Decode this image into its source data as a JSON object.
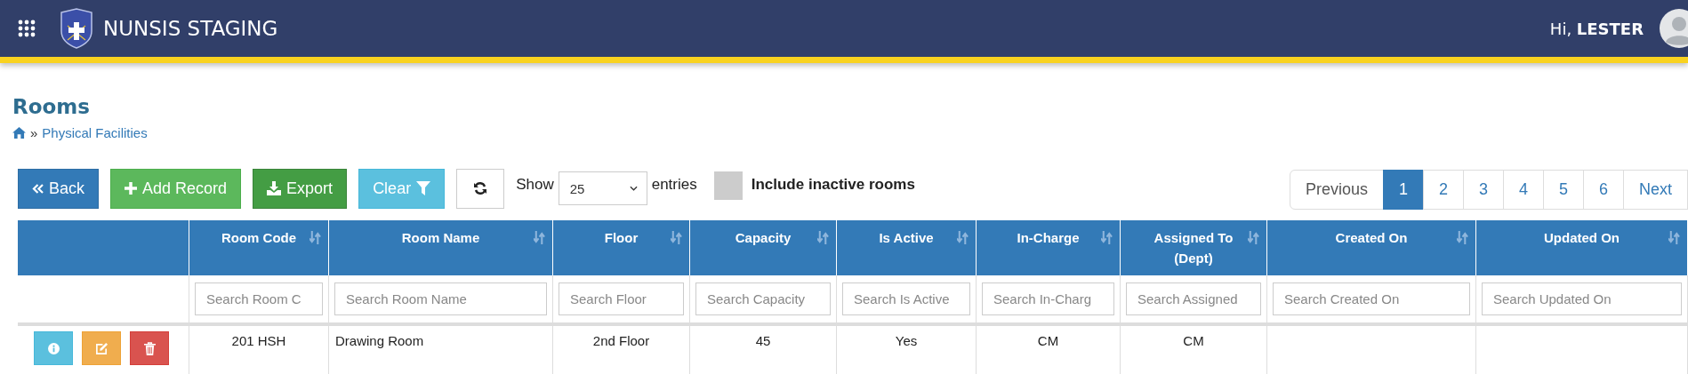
{
  "header": {
    "title": "NUNSIS STAGING",
    "greeting": "Hi, **LESTER**"
  },
  "page": {
    "title": "Rooms",
    "breadcrumb_separator": "»",
    "breadcrumb": "Physical Facilities"
  },
  "toolbar": {
    "buttons": [
      {
        "label": "Back",
        "kind": "back"
      },
      {
        "label": "Add Record",
        "kind": "add"
      },
      {
        "label": "Export",
        "kind": "export"
      },
      {
        "label": "Clear",
        "kind": "clear"
      },
      {
        "kind": "refresh"
      }
    ],
    "show_label": "Show",
    "entries_value": "25",
    "entries_label": "entries",
    "include_inactive": {
      "label": "Include inactive rooms",
      "checked": false
    }
  },
  "pagination": [
    {
      "label": "Previous",
      "selected": false
    },
    {
      "label": "1",
      "selected": true
    },
    {
      "label": "2",
      "selected": false
    },
    {
      "label": "3",
      "selected": false
    },
    {
      "label": "4",
      "selected": false
    },
    {
      "label": "5",
      "selected": false
    },
    {
      "label": "6",
      "selected": false
    },
    {
      "label": "Next",
      "selected": false
    }
  ],
  "table": {
    "columns": [
      {
        "label": "Room Code",
        "placeholder": "Search Room C"
      },
      {
        "label": "Room Name",
        "placeholder": "Search Room Name"
      },
      {
        "label": "Floor",
        "placeholder": "Search Floor"
      },
      {
        "label": "Capacity",
        "placeholder": "Search Capacity"
      },
      {
        "label": "Is Active",
        "placeholder": "Search Is Active"
      },
      {
        "label": "In-Charge",
        "placeholder": "Search In-Charg"
      },
      {
        "label": "Assigned To (Dept)",
        "placeholder": "Search Assigned"
      },
      {
        "label": "Created On",
        "placeholder": "Search Created On"
      },
      {
        "label": "Updated On",
        "placeholder": "Search Updated On"
      }
    ],
    "rows": [
      {
        "cells": [
          "201 HSH",
          "Drawing Room",
          "2nd Floor",
          "45",
          "Yes",
          "CM",
          "CM",
          null,
          null
        ]
      }
    ]
  }
}
